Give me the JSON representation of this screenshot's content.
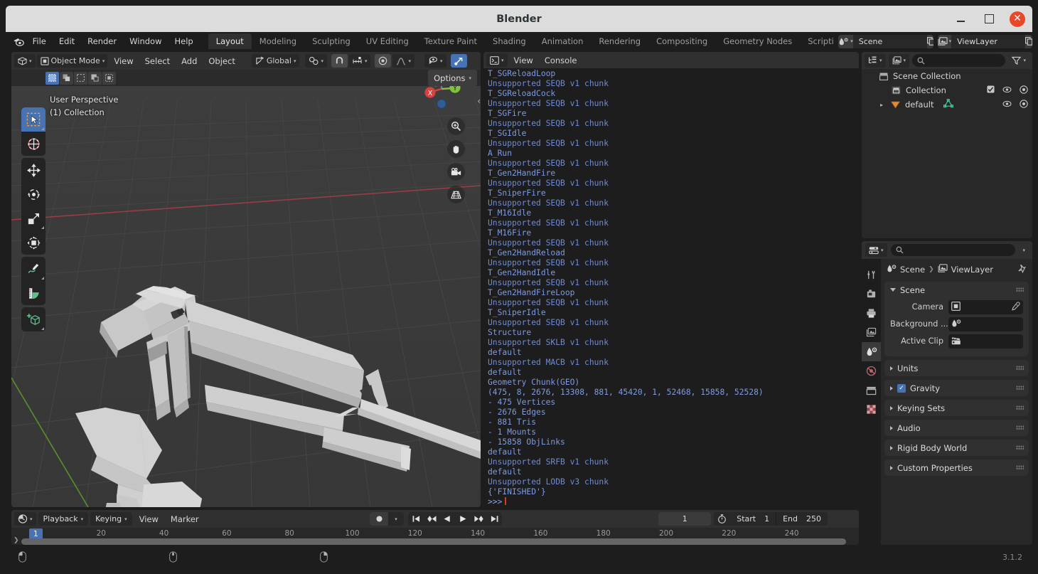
{
  "window": {
    "title": "Blender",
    "controls": {
      "minimize": "minimize-icon",
      "maximize": "maximize-icon",
      "close": "✕"
    }
  },
  "topbar": {
    "logo": "blender-logo-icon",
    "menus": [
      "File",
      "Edit",
      "Render",
      "Window",
      "Help"
    ],
    "workspaces": [
      {
        "label": "Layout",
        "active": true
      },
      {
        "label": "Modeling",
        "active": false
      },
      {
        "label": "Sculpting",
        "active": false
      },
      {
        "label": "UV Editing",
        "active": false
      },
      {
        "label": "Texture Paint",
        "active": false
      },
      {
        "label": "Shading",
        "active": false
      },
      {
        "label": "Animation",
        "active": false
      },
      {
        "label": "Rendering",
        "active": false
      },
      {
        "label": "Compositing",
        "active": false
      },
      {
        "label": "Geometry Nodes",
        "active": false
      },
      {
        "label": "Scripting",
        "active": false
      }
    ],
    "scene": {
      "name": "Scene",
      "new_label": "new-scene-icon",
      "remove_label": "×"
    },
    "viewlayer": {
      "name": "ViewLayer",
      "new_label": "new-viewlayer-icon",
      "remove_label": "×"
    }
  },
  "viewport": {
    "editor_type": "editor-type-3d-viewport",
    "mode": "Object Mode",
    "menus": [
      "View",
      "Select",
      "Add",
      "Object"
    ],
    "transform_orientation": "Global",
    "options_label": "Options",
    "overlay": {
      "perspective": "User Perspective",
      "collection": "(1) Collection"
    },
    "gizmo_axes": [
      "X",
      "Y",
      "Z"
    ],
    "nav_buttons": [
      "zoom-icon",
      "pan-hand-icon",
      "camera-view-icon",
      "toggle-ortho-icon"
    ],
    "tools": [
      {
        "name": "tweak-select-box-tool",
        "active": true
      },
      {
        "name": "cursor-tool",
        "active": false
      },
      {
        "name": "move-tool",
        "active": false
      },
      {
        "name": "rotate-tool",
        "active": false
      },
      {
        "name": "scale-tool",
        "active": false
      },
      {
        "name": "transform-tool",
        "active": false
      },
      {
        "name": "annotate-tool",
        "active": false
      },
      {
        "name": "measure-tool",
        "active": false
      },
      {
        "name": "add-cube-tool",
        "active": false
      }
    ],
    "select_modes": [
      "select-box",
      "select-extend",
      "select-subtract",
      "select-invert",
      "select-intersect"
    ]
  },
  "console": {
    "editor_type": "editor-type-python-console",
    "menus": [
      "View",
      "Console"
    ],
    "lines": [
      {
        "text": "T_SGReloadLoop",
        "kind": "out"
      },
      {
        "text": "Unsupported SEQB v1 chunk",
        "kind": "info"
      },
      {
        "text": "T_SGReloadCock",
        "kind": "out"
      },
      {
        "text": "Unsupported SEQB v1 chunk",
        "kind": "info"
      },
      {
        "text": "T_SGFire",
        "kind": "out"
      },
      {
        "text": "Unsupported SEQB v1 chunk",
        "kind": "info"
      },
      {
        "text": "T_SGIdle",
        "kind": "out"
      },
      {
        "text": "Unsupported SEQB v1 chunk",
        "kind": "info"
      },
      {
        "text": "A_Run",
        "kind": "out"
      },
      {
        "text": "Unsupported SEQB v1 chunk",
        "kind": "info"
      },
      {
        "text": "T_Gen2HandFire",
        "kind": "out"
      },
      {
        "text": "Unsupported SEQB v1 chunk",
        "kind": "info"
      },
      {
        "text": "T_SniperFire",
        "kind": "out"
      },
      {
        "text": "Unsupported SEQB v1 chunk",
        "kind": "info"
      },
      {
        "text": "T_M16Idle",
        "kind": "out"
      },
      {
        "text": "Unsupported SEQB v1 chunk",
        "kind": "info"
      },
      {
        "text": "T_M16Fire",
        "kind": "out"
      },
      {
        "text": "Unsupported SEQB v1 chunk",
        "kind": "info"
      },
      {
        "text": "T_Gen2HandReload",
        "kind": "out"
      },
      {
        "text": "Unsupported SEQB v1 chunk",
        "kind": "info"
      },
      {
        "text": "T_Gen2HandIdle",
        "kind": "out"
      },
      {
        "text": "Unsupported SEQB v1 chunk",
        "kind": "info"
      },
      {
        "text": "T_Gen2HandFireLoop",
        "kind": "out"
      },
      {
        "text": "Unsupported SEQB v1 chunk",
        "kind": "info"
      },
      {
        "text": "T_SniperIdle",
        "kind": "out"
      },
      {
        "text": "Unsupported SEQB v1 chunk",
        "kind": "info"
      },
      {
        "text": "Structure",
        "kind": "out"
      },
      {
        "text": "Unsupported SKLB v1 chunk",
        "kind": "info"
      },
      {
        "text": "default",
        "kind": "out"
      },
      {
        "text": "Unsupported MACB v1 chunk",
        "kind": "info"
      },
      {
        "text": "default",
        "kind": "out"
      },
      {
        "text": "Geometry Chunk(GEO)",
        "kind": "out"
      },
      {
        "text": "(475, 8, 2676, 13308, 881, 45420, 1, 52468, 15858, 52528)",
        "kind": "out"
      },
      {
        "text": "- 475 Vertices",
        "kind": "out"
      },
      {
        "text": "- 2676 Edges",
        "kind": "out"
      },
      {
        "text": "- 881 Tris",
        "kind": "out"
      },
      {
        "text": "- 1 Mounts",
        "kind": "out"
      },
      {
        "text": "- 15858 ObjLinks",
        "kind": "out"
      },
      {
        "text": "default",
        "kind": "out"
      },
      {
        "text": "Unsupported SRFB v1 chunk",
        "kind": "info"
      },
      {
        "text": "default",
        "kind": "out"
      },
      {
        "text": "Unsupported LODB v3 chunk",
        "kind": "info"
      },
      {
        "text": "{'FINISHED'}",
        "kind": "fin"
      },
      {
        "text": "",
        "kind": "out"
      }
    ],
    "prompt": ">>>"
  },
  "outliner": {
    "editor_type": "editor-type-outliner",
    "display_mode": "view-layer-icon",
    "search_placeholder": "",
    "filter_icon": "filter-funnel-icon",
    "rows": [
      {
        "label": "Scene Collection",
        "icon": "collection-icon",
        "indent": 0,
        "expand": "",
        "checkbox": false,
        "eye": false,
        "camera": false
      },
      {
        "label": "Collection",
        "icon": "collection-icon",
        "indent": 1,
        "expand": "",
        "checkbox": true,
        "eye": true,
        "camera": true
      },
      {
        "label": "default",
        "icon": "mesh-object-icon",
        "indent": 1,
        "expand": "▸",
        "checkbox": false,
        "eye": true,
        "camera": true,
        "data_icon": "mesh-data-icon"
      }
    ]
  },
  "properties": {
    "editor_type": "editor-type-properties",
    "search_placeholder": "",
    "breadcrumb": [
      "Scene",
      "ViewLayer"
    ],
    "tabs": [
      {
        "name": "tool-tab",
        "active": false
      },
      {
        "name": "render-tab",
        "active": false
      },
      {
        "name": "output-tab",
        "active": false
      },
      {
        "name": "view-layer-tab",
        "active": false
      },
      {
        "name": "scene-tab",
        "active": true
      },
      {
        "name": "world-tab",
        "active": false
      },
      {
        "name": "collection-tab",
        "active": false
      },
      {
        "name": "texture-tab",
        "active": false
      }
    ],
    "panels": [
      {
        "title": "Scene",
        "open": true,
        "fields": [
          {
            "label": "Camera",
            "value": "",
            "icon": "camera-data-icon",
            "eyedropper": true
          },
          {
            "label": "Background ...",
            "value": "",
            "icon": "scene-icon",
            "eyedropper": false
          },
          {
            "label": "Active Clip",
            "value": "",
            "icon": "movie-clip-icon",
            "eyedropper": false
          }
        ]
      },
      {
        "title": "Units",
        "open": false,
        "checkbox": null
      },
      {
        "title": "Gravity",
        "open": false,
        "checkbox": true
      },
      {
        "title": "Keying Sets",
        "open": false,
        "checkbox": null
      },
      {
        "title": "Audio",
        "open": false,
        "checkbox": null
      },
      {
        "title": "Rigid Body World",
        "open": false,
        "checkbox": null
      },
      {
        "title": "Custom Properties",
        "open": false,
        "checkbox": null
      }
    ]
  },
  "timeline": {
    "editor_type": "editor-type-timeline",
    "menus": [
      {
        "label": "Playback",
        "dropdown": true
      },
      {
        "label": "Keying",
        "dropdown": true
      },
      {
        "label": "View",
        "dropdown": false
      },
      {
        "label": "Marker",
        "dropdown": false
      }
    ],
    "record_icon": "auto-keying-icon",
    "transport": [
      "jump-start-icon",
      "prev-keyframe-icon",
      "play-reverse-icon",
      "play-icon",
      "next-keyframe-icon",
      "jump-end-icon"
    ],
    "current_frame": "1",
    "start_label": "Start",
    "start_value": "1",
    "end_label": "End",
    "end_value": "250",
    "timer_icon": "use-preview-range-icon",
    "ruler_ticks": [
      "1",
      "20",
      "40",
      "60",
      "80",
      "100",
      "120",
      "140",
      "160",
      "180",
      "200",
      "220",
      "240"
    ],
    "playhead_frame": "1"
  },
  "statusbar": {
    "items": [
      {
        "icon": "mouse-left-icon",
        "label": ""
      },
      {
        "icon": "mouse-middle-icon",
        "label": ""
      },
      {
        "icon": "mouse-right-icon",
        "label": ""
      }
    ],
    "version": "3.1.2"
  },
  "colors": {
    "accent": "#4772b3",
    "panel_bg": "#303030",
    "editor_bg": "#282828",
    "window_bg": "#1d1d1d",
    "viewport_bg": "#393939",
    "console_info": "#6f8ad4",
    "axis_x": "#9e3c48",
    "axis_y": "#5a8f2c",
    "close_red": "#e8472a"
  }
}
